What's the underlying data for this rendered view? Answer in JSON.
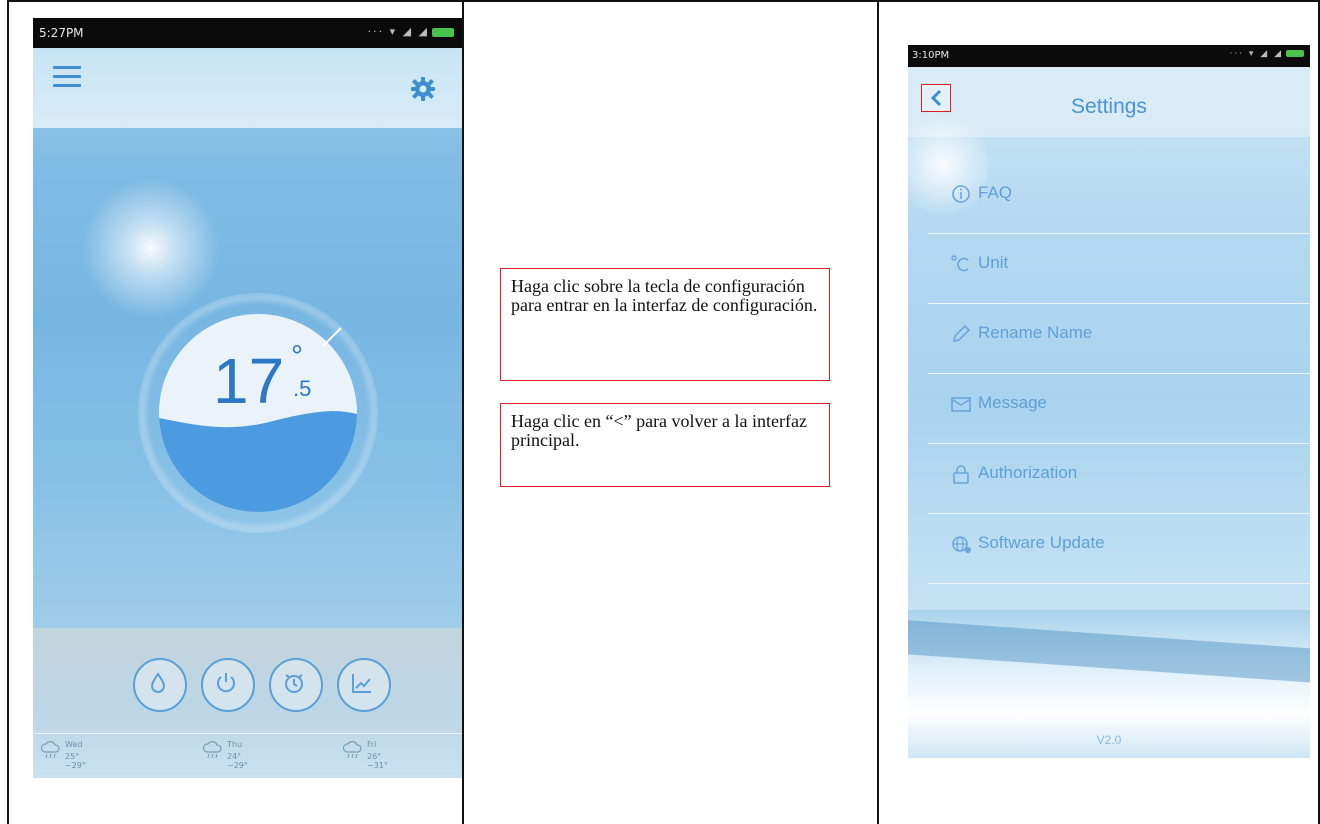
{
  "left_phone": {
    "status_time": "5:27PM",
    "temperature": {
      "whole": "17",
      "degree_mark": "°",
      "decimal": ".5"
    },
    "controls": [
      {
        "icon": "dehumidify-icon"
      },
      {
        "icon": "power-icon"
      },
      {
        "icon": "alarm-clock-icon"
      },
      {
        "icon": "chart-icon"
      }
    ],
    "forecast": [
      {
        "day": "Wed",
        "range": "25° ~29°",
        "icon": "cloud-rain-icon"
      },
      {
        "day": "Thu",
        "range": "24° ~29°",
        "icon": "cloud-rain-icon"
      },
      {
        "day": "Fri",
        "range": "26° ~31°",
        "icon": "cloud-rain-icon"
      }
    ],
    "colors": {
      "accent": "#3e8ed2",
      "temperature": "#2b78c7"
    }
  },
  "annotations": {
    "note1": "Haga clic sobre la tecla de configuración para entrar en la interfaz de configuración.",
    "note2": "Haga clic en “<” para volver a la interfaz principal.",
    "border_color": "#e02020"
  },
  "right_phone": {
    "status_time": "3:10PM",
    "title": "Settings",
    "back_label": "<",
    "items": [
      {
        "label": "FAQ",
        "icon": "info-icon"
      },
      {
        "label": "Unit",
        "icon": "celsius-icon"
      },
      {
        "label": "Rename Name",
        "icon": "pencil-icon"
      },
      {
        "label": "Message",
        "icon": "envelope-icon"
      },
      {
        "label": "Authorization",
        "icon": "lock-icon"
      },
      {
        "label": "Software Update",
        "icon": "globe-update-icon"
      }
    ],
    "version": "V2.0",
    "colors": {
      "accent": "#4a93d4"
    }
  }
}
